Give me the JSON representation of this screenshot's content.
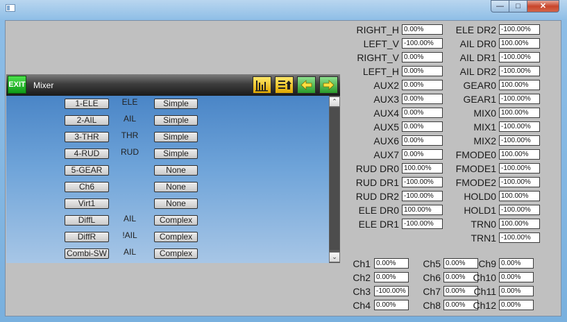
{
  "mixer": {
    "exit_label": "EXIT",
    "title": "Mixer",
    "channels": [
      {
        "name": "1-ELE",
        "source": "ELE",
        "mode": "Simple"
      },
      {
        "name": "2-AIL",
        "source": "AIL",
        "mode": "Simple"
      },
      {
        "name": "3-THR",
        "source": "THR",
        "mode": "Simple"
      },
      {
        "name": "4-RUD",
        "source": "RUD",
        "mode": "Simple"
      },
      {
        "name": "5-GEAR",
        "source": "",
        "mode": "None"
      },
      {
        "name": "Ch6",
        "source": "",
        "mode": "None"
      },
      {
        "name": "Virt1",
        "source": "",
        "mode": "None"
      },
      {
        "name": "DiffL",
        "source": "AIL",
        "mode": "Complex"
      },
      {
        "name": "DiffR",
        "source": "!AIL",
        "mode": "Complex"
      },
      {
        "name": "Combi-SW",
        "source": "AIL",
        "mode": "Complex"
      }
    ]
  },
  "inputs_left": [
    {
      "label": "RIGHT_H",
      "value": "0.00%"
    },
    {
      "label": "LEFT_V",
      "value": "-100.00%"
    },
    {
      "label": "RIGHT_V",
      "value": "0.00%"
    },
    {
      "label": "LEFT_H",
      "value": "0.00%"
    },
    {
      "label": "AUX2",
      "value": "0.00%"
    },
    {
      "label": "AUX3",
      "value": "0.00%"
    },
    {
      "label": "AUX4",
      "value": "0.00%"
    },
    {
      "label": "AUX5",
      "value": "0.00%"
    },
    {
      "label": "AUX6",
      "value": "0.00%"
    },
    {
      "label": "AUX7",
      "value": "0.00%"
    },
    {
      "label": "RUD DR0",
      "value": "100.00%"
    },
    {
      "label": "RUD DR1",
      "value": "-100.00%"
    },
    {
      "label": "RUD DR2",
      "value": "-100.00%"
    },
    {
      "label": "ELE DR0",
      "value": "100.00%"
    },
    {
      "label": "ELE DR1",
      "value": "-100.00%"
    }
  ],
  "inputs_right": [
    {
      "label": "ELE DR2",
      "value": "-100.00%"
    },
    {
      "label": "AIL DR0",
      "value": "100.00%"
    },
    {
      "label": "AIL DR1",
      "value": "-100.00%"
    },
    {
      "label": "AIL DR2",
      "value": "-100.00%"
    },
    {
      "label": "GEAR0",
      "value": "100.00%"
    },
    {
      "label": "GEAR1",
      "value": "-100.00%"
    },
    {
      "label": "MIX0",
      "value": "100.00%"
    },
    {
      "label": "MIX1",
      "value": "-100.00%"
    },
    {
      "label": "MIX2",
      "value": "-100.00%"
    },
    {
      "label": "FMODE0",
      "value": "100.00%"
    },
    {
      "label": "FMODE1",
      "value": "-100.00%"
    },
    {
      "label": "FMODE2",
      "value": "-100.00%"
    },
    {
      "label": "HOLD0",
      "value": "100.00%"
    },
    {
      "label": "HOLD1",
      "value": "-100.00%"
    },
    {
      "label": "TRN0",
      "value": "100.00%"
    },
    {
      "label": "TRN1",
      "value": "-100.00%"
    }
  ],
  "outputs": [
    {
      "label": "Ch1",
      "value": "0.00%"
    },
    {
      "label": "Ch2",
      "value": "0.00%"
    },
    {
      "label": "Ch3",
      "value": "-100.00%"
    },
    {
      "label": "Ch4",
      "value": "0.00%"
    },
    {
      "label": "Ch5",
      "value": "0.00%"
    },
    {
      "label": "Ch6",
      "value": "0.00%"
    },
    {
      "label": "Ch7",
      "value": "0.00%"
    },
    {
      "label": "Ch8",
      "value": "0.00%"
    },
    {
      "label": "Ch9",
      "value": "0.00%"
    },
    {
      "label": "Ch10",
      "value": "0.00%"
    },
    {
      "label": "Ch11",
      "value": "0.00%"
    },
    {
      "label": "Ch12",
      "value": "0.00%"
    }
  ],
  "icons": {
    "app": "app-window-icon",
    "monitor": "bar-chart-icon",
    "reorder": "reorder-list-icon",
    "prev": "arrow-left-icon",
    "next": "arrow-right-icon"
  },
  "colors": {
    "exit_button": "#1fb32a",
    "toolbar_buttons": "#f5c400",
    "nav_buttons": "#3aaa3a"
  }
}
